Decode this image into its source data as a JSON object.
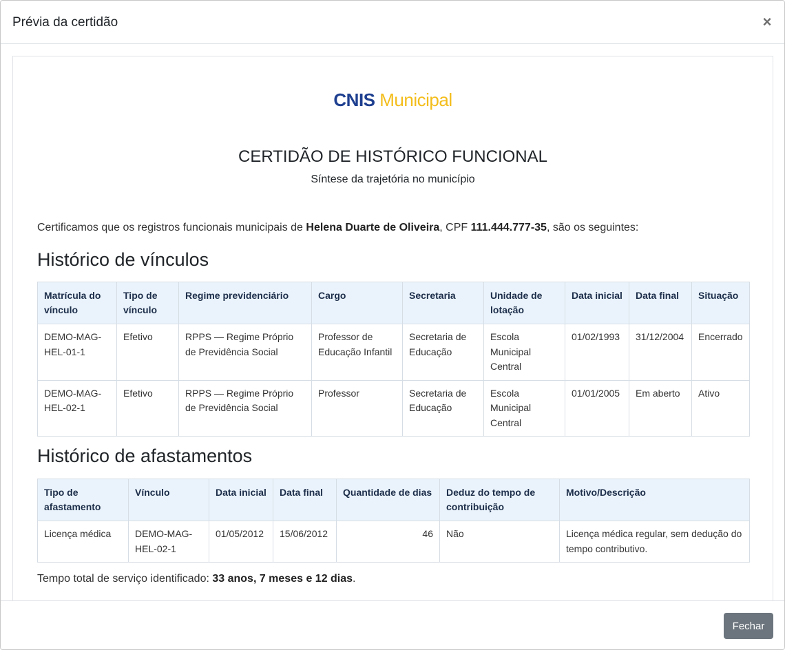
{
  "modal": {
    "title": "Prévia da certidão",
    "close_glyph": "×",
    "close_button_label": "Fechar"
  },
  "logo": {
    "part1": "CNIS",
    "part2": "Municipal"
  },
  "document": {
    "title": "CERTIDÃO DE HISTÓRICO FUNCIONAL",
    "subtitle": "Síntese da trajetória no município",
    "intro_prefix": "Certificamos que os registros funcionais municipais de ",
    "person_name": "Helena Duarte de Oliveira",
    "intro_mid": ", CPF ",
    "cpf": "111.444.777-35",
    "intro_suffix": ", são os seguintes:",
    "total_prefix": "Tempo total de serviço identificado: ",
    "total_value": "33 anos, 7 meses e 12 dias",
    "total_suffix": "."
  },
  "vinculos": {
    "title": "Histórico de vínculos",
    "headers": [
      "Matrícula do vínculo",
      "Tipo de vínculo",
      "Regime previdenciário",
      "Cargo",
      "Secretaria",
      "Unidade de lotação",
      "Data inicial",
      "Data final",
      "Situação"
    ],
    "rows": [
      [
        "DEMO-MAG-HEL-01-1",
        "Efetivo",
        "RPPS — Regime Próprio de Previdência Social",
        "Professor de Educação Infantil",
        "Secretaria de Educação",
        "Escola Municipal Central",
        "01/02/1993",
        "31/12/2004",
        "Encerrado"
      ],
      [
        "DEMO-MAG-HEL-02-1",
        "Efetivo",
        "RPPS — Regime Próprio de Previdência Social",
        "Professor",
        "Secretaria de Educação",
        "Escola Municipal Central",
        "01/01/2005",
        "Em aberto",
        "Ativo"
      ]
    ]
  },
  "afastamentos": {
    "title": "Histórico de afastamentos",
    "headers": [
      "Tipo de afastamento",
      "Vínculo",
      "Data inicial",
      "Data final",
      "Quantidade de dias",
      "Deduz do tempo de contribuição",
      "Motivo/Descrição"
    ],
    "rows": [
      [
        "Licença médica",
        "DEMO-MAG-HEL-02-1",
        "01/05/2012",
        "15/06/2012",
        "46",
        "Não",
        "Licença médica regular, sem dedução do tempo contributivo."
      ]
    ]
  },
  "colors": {
    "logo_blue": "#1e3f8f",
    "logo_yellow": "#f3bd1b",
    "table_header_bg": "#eaf3fb",
    "button_bg": "#6c757d"
  }
}
